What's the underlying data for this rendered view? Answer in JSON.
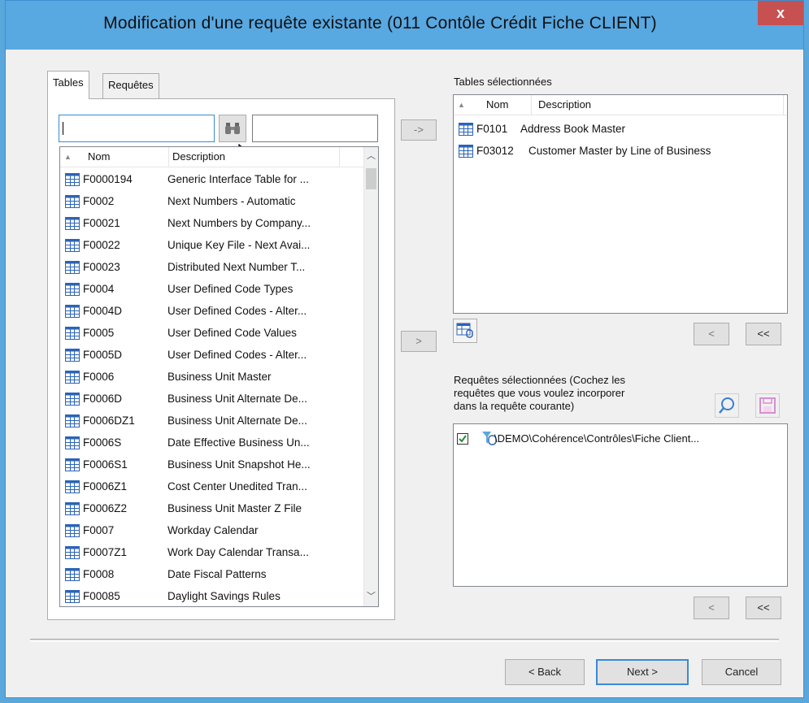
{
  "window": {
    "title": "Modification d'une requête existante (011 Contôle Crédit Fiche CLIENT)",
    "close_glyph": "x"
  },
  "tabs": [
    {
      "label": "Tables",
      "active": true
    },
    {
      "label": "Requêtes",
      "active": false
    }
  ],
  "search": {
    "value": "",
    "filter_value": "",
    "find_icon": "binoculars-icon"
  },
  "tables_list": {
    "headers": [
      "Nom",
      "Description"
    ],
    "rows": [
      {
        "code": "F0000194",
        "desc": "Generic Interface Table for ..."
      },
      {
        "code": "F0002",
        "desc": "Next Numbers - Automatic"
      },
      {
        "code": "F00021",
        "desc": "Next Numbers by Company..."
      },
      {
        "code": "F00022",
        "desc": "Unique Key File - Next Avai..."
      },
      {
        "code": "F00023",
        "desc": "Distributed Next Number T..."
      },
      {
        "code": "F0004",
        "desc": "User Defined Code Types"
      },
      {
        "code": "F0004D",
        "desc": "User Defined Codes - Alter..."
      },
      {
        "code": "F0005",
        "desc": "User Defined Code Values"
      },
      {
        "code": "F0005D",
        "desc": "User Defined Codes - Alter..."
      },
      {
        "code": "F0006",
        "desc": "Business Unit Master"
      },
      {
        "code": "F0006D",
        "desc": "Business Unit Alternate De..."
      },
      {
        "code": "F0006DZ1",
        "desc": "Business Unit Alternate De..."
      },
      {
        "code": "F0006S",
        "desc": "Date Effective Business Un..."
      },
      {
        "code": "F0006S1",
        "desc": "Business Unit Snapshot He..."
      },
      {
        "code": "F0006Z1",
        "desc": "Cost Center Unedited Tran..."
      },
      {
        "code": "F0006Z2",
        "desc": "Business Unit Master Z File"
      },
      {
        "code": "F0007",
        "desc": "Workday Calendar"
      },
      {
        "code": "F0007Z1",
        "desc": "Work Day Calendar Transa..."
      },
      {
        "code": "F0008",
        "desc": "Date Fiscal Patterns"
      },
      {
        "code": "F00085",
        "desc": "Daylight Savings Rules"
      }
    ]
  },
  "transfer": {
    "add_table": "->",
    "add_query": ">"
  },
  "selected_tables": {
    "label": "Tables sélectionnées",
    "headers": [
      "Nom",
      "Description"
    ],
    "rows": [
      {
        "code": "F0101",
        "desc": "Address Book Master"
      },
      {
        "code": "F03012",
        "desc": "Customer Master by Line of Business"
      }
    ],
    "remove": "<",
    "remove_all": "<<"
  },
  "selected_queries": {
    "label_line1": "Requêtes sélectionnées (Cochez les",
    "label_line2": "requêtes que vous voulez incorporer",
    "label_line3": "dans la requête courante)",
    "items": [
      {
        "path": "\\DEMO\\Cohérence\\Contrôles\\Fiche Client...",
        "checked": true
      }
    ],
    "remove": "<",
    "remove_all": "<<"
  },
  "footer": {
    "back": "< Back",
    "next": "Next >",
    "cancel": "Cancel"
  },
  "colors": {
    "titlebar": "#58a8e1",
    "close": "#c75050",
    "table_icon": "#2b64b8"
  }
}
